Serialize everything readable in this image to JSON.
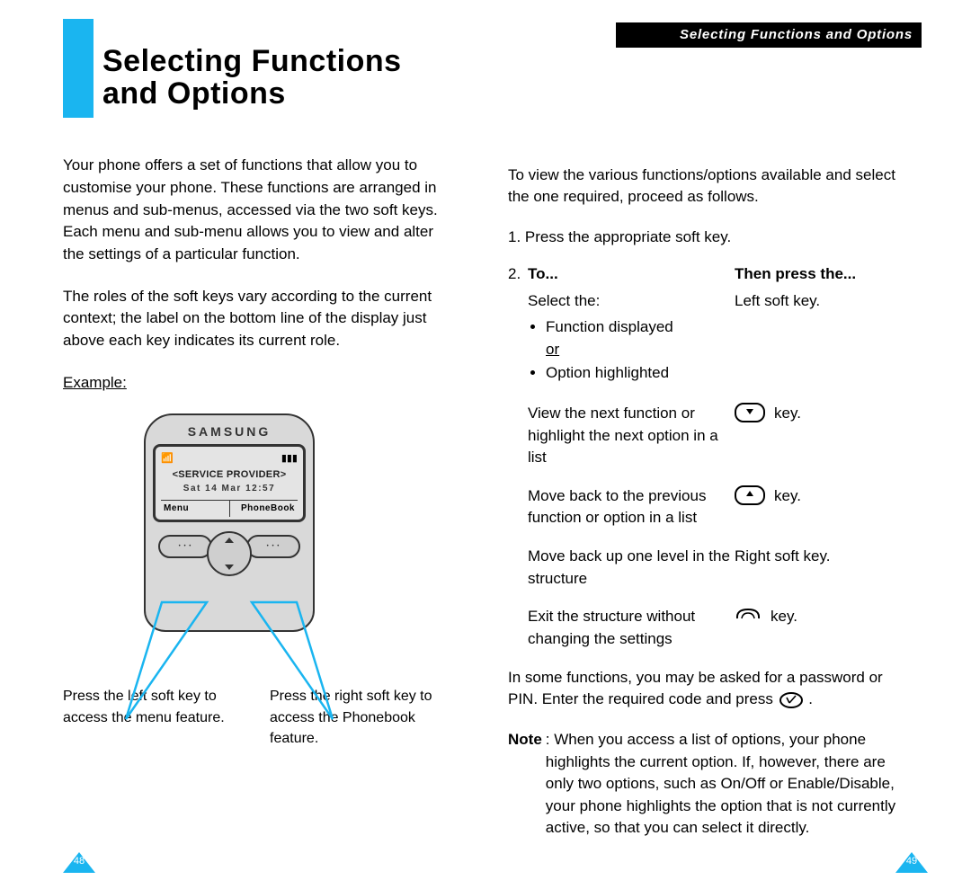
{
  "running_header": "Selecting Functions and Options",
  "title": "Selecting Functions\nand Options",
  "left": {
    "para1": "Your phone offers a set of functions that allow you to customise your phone. These functions are arranged in menus and sub-menus, accessed via the two soft keys. Each menu and sub-menu allows you to view and alter the settings of a particular function.",
    "para2": "The roles of the soft keys vary according to the current context; the label on the bottom line of the display just above each key indicates its current role.",
    "example_label": "Example:",
    "phone": {
      "brand": "SAMSUNG",
      "service": "<SERVICE PROVIDER>",
      "date": "Sat 14 Mar 12:57",
      "soft_left": "Menu",
      "soft_right": "PhoneBook"
    },
    "caption_left": "Press the left soft key to access the menu feature.",
    "caption_right": "Press the right soft key to access the Phonebook feature."
  },
  "right": {
    "intro": "To view the various functions/options available and select the one required, proceed as follows.",
    "step1_num": "1.",
    "step1": "Press the appropriate soft key.",
    "step2_num": "2.",
    "hdr_to": "To...",
    "hdr_then": "Then press the...",
    "rows": {
      "r1": {
        "left_lead": "Select the:",
        "b1": "Function displayed",
        "or": "or",
        "b2": "Option highlighted",
        "right_text": "Left soft key."
      },
      "r2": {
        "left": "View the next function or highlight the next option in a list",
        "right_text": "key."
      },
      "r3": {
        "left": "Move back to the previous function or option in a list",
        "right_text": "key."
      },
      "r4": {
        "left": "Move back up one level in the structure",
        "right_text": "Right soft key."
      },
      "r5": {
        "left": "Exit the structure without changing the settings",
        "right_text": "key."
      }
    },
    "footer_para_a": "In some functions, you may be asked for a password or PIN. Enter the required code and press ",
    "footer_para_b": ".",
    "note_label": "Note",
    "note_text": ": When you access a list of options, your phone highlights the current option. If, however, there are only two options, such as On/Off or Enable/Disable, your phone highlights the option that is not currently active, so that you can select it directly."
  },
  "page_left": "48",
  "page_right": "49"
}
